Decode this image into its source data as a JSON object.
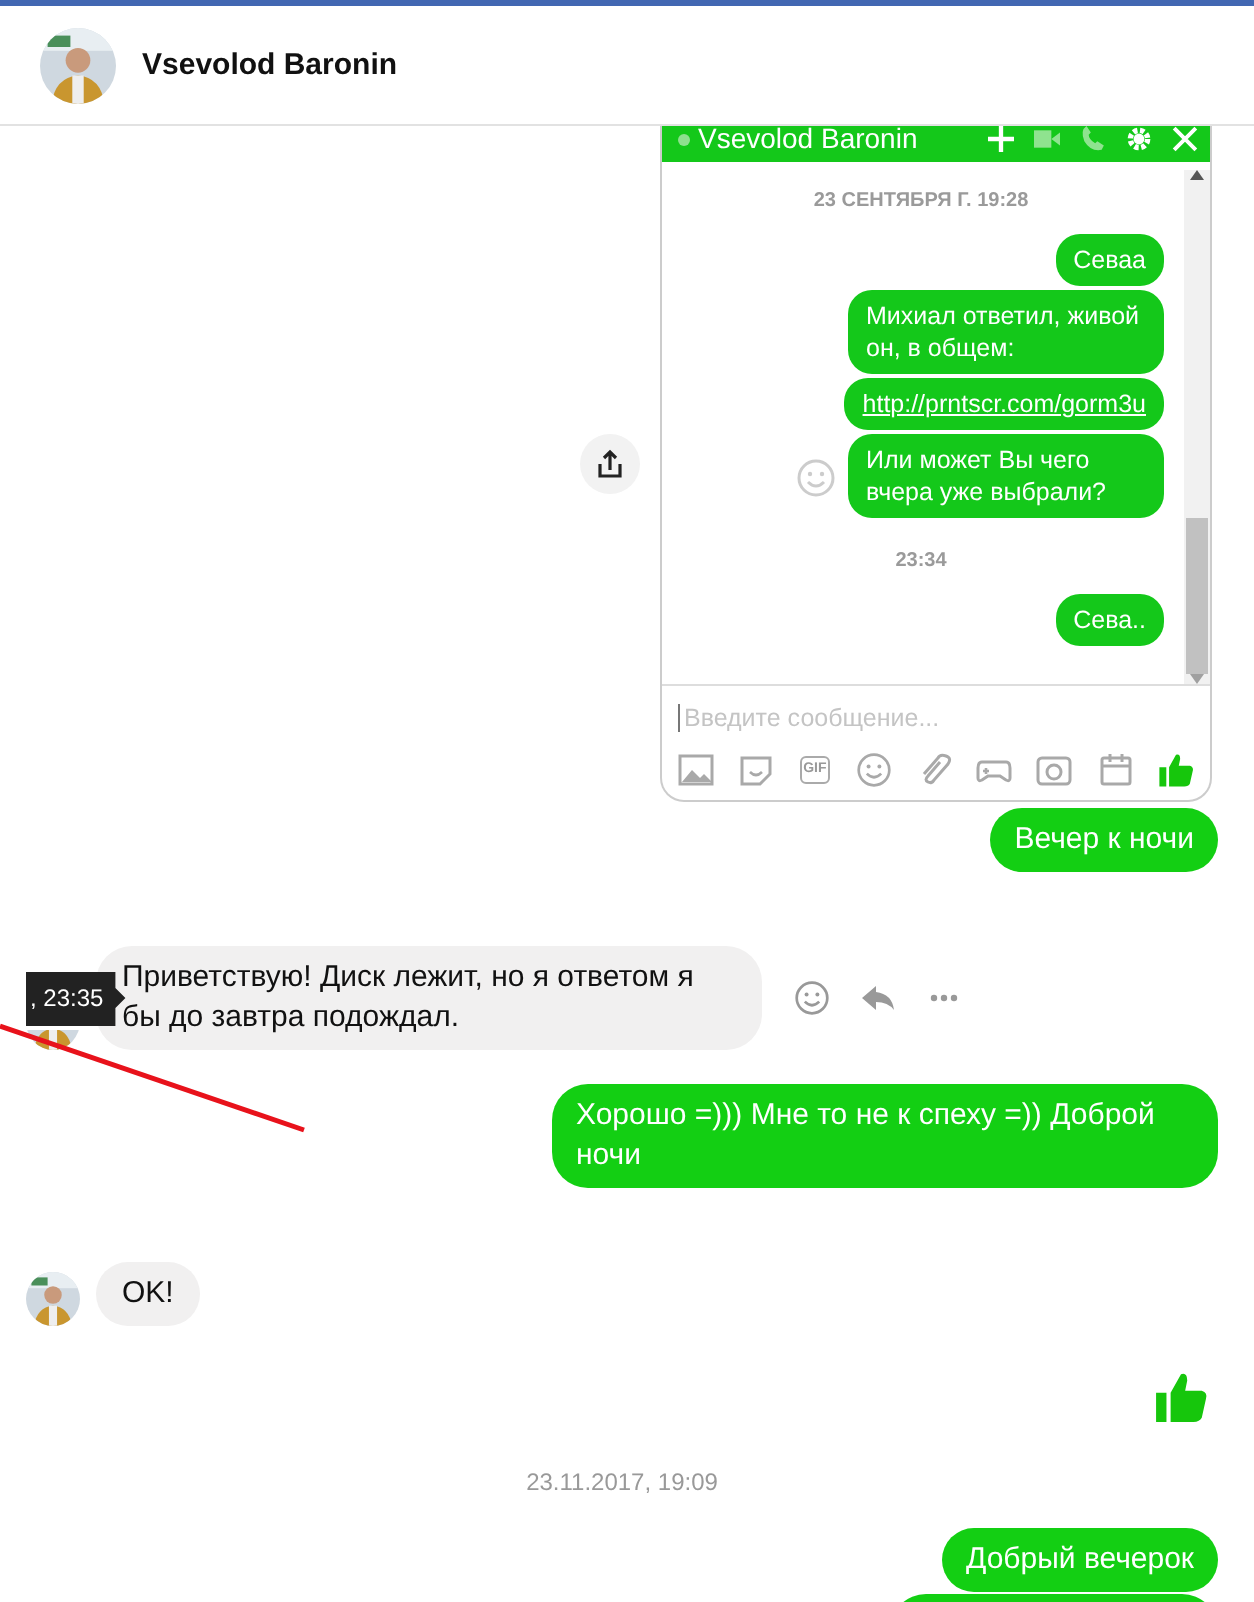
{
  "header": {
    "name": "Vsevolod Baronin"
  },
  "attachment": {
    "kind": "screenshot",
    "title": "Vsevolod Baronin",
    "online": true,
    "placeholder": "Введите сообщение...",
    "gif_label": "GIF",
    "items": [
      {
        "kind": "date",
        "text": "23 СЕНТЯБРЯ Г. 19:28"
      },
      {
        "kind": "message",
        "text": "Севаа",
        "reaction_button": false
      },
      {
        "kind": "message",
        "text": "Михиал ответил, живой он, в общем:",
        "reaction_button": false
      },
      {
        "kind": "link",
        "text": "http://prntscr.com/gorm3u"
      },
      {
        "kind": "message",
        "text": "Или может Вы чего вчера уже выбрали?",
        "reaction_button": true
      },
      {
        "kind": "date",
        "text": "23:34"
      },
      {
        "kind": "message",
        "text": "Сева..",
        "reaction_button": false
      }
    ]
  },
  "messages": [
    {
      "kind": "text",
      "outgoing": true,
      "text": "Вечер к ночи"
    },
    {
      "kind": "text",
      "outgoing": false,
      "text": "Приветствую! Диск лежит, но я ответом я бы до завтра подождал.",
      "tooltip": ", 23:35",
      "hovered": true
    },
    {
      "kind": "text",
      "outgoing": true,
      "text": "Хорошо =))) Мне то не к спеху =)) Доброй ночи"
    },
    {
      "kind": "text",
      "outgoing": false,
      "text": "OK!",
      "hovered": false
    },
    {
      "kind": "like"
    },
    {
      "kind": "date",
      "text": "23.11.2017, 19:09"
    },
    {
      "kind": "text",
      "outgoing": true,
      "text": "Добрый вечерок"
    },
    {
      "kind": "partial",
      "outgoing": true
    }
  ]
}
